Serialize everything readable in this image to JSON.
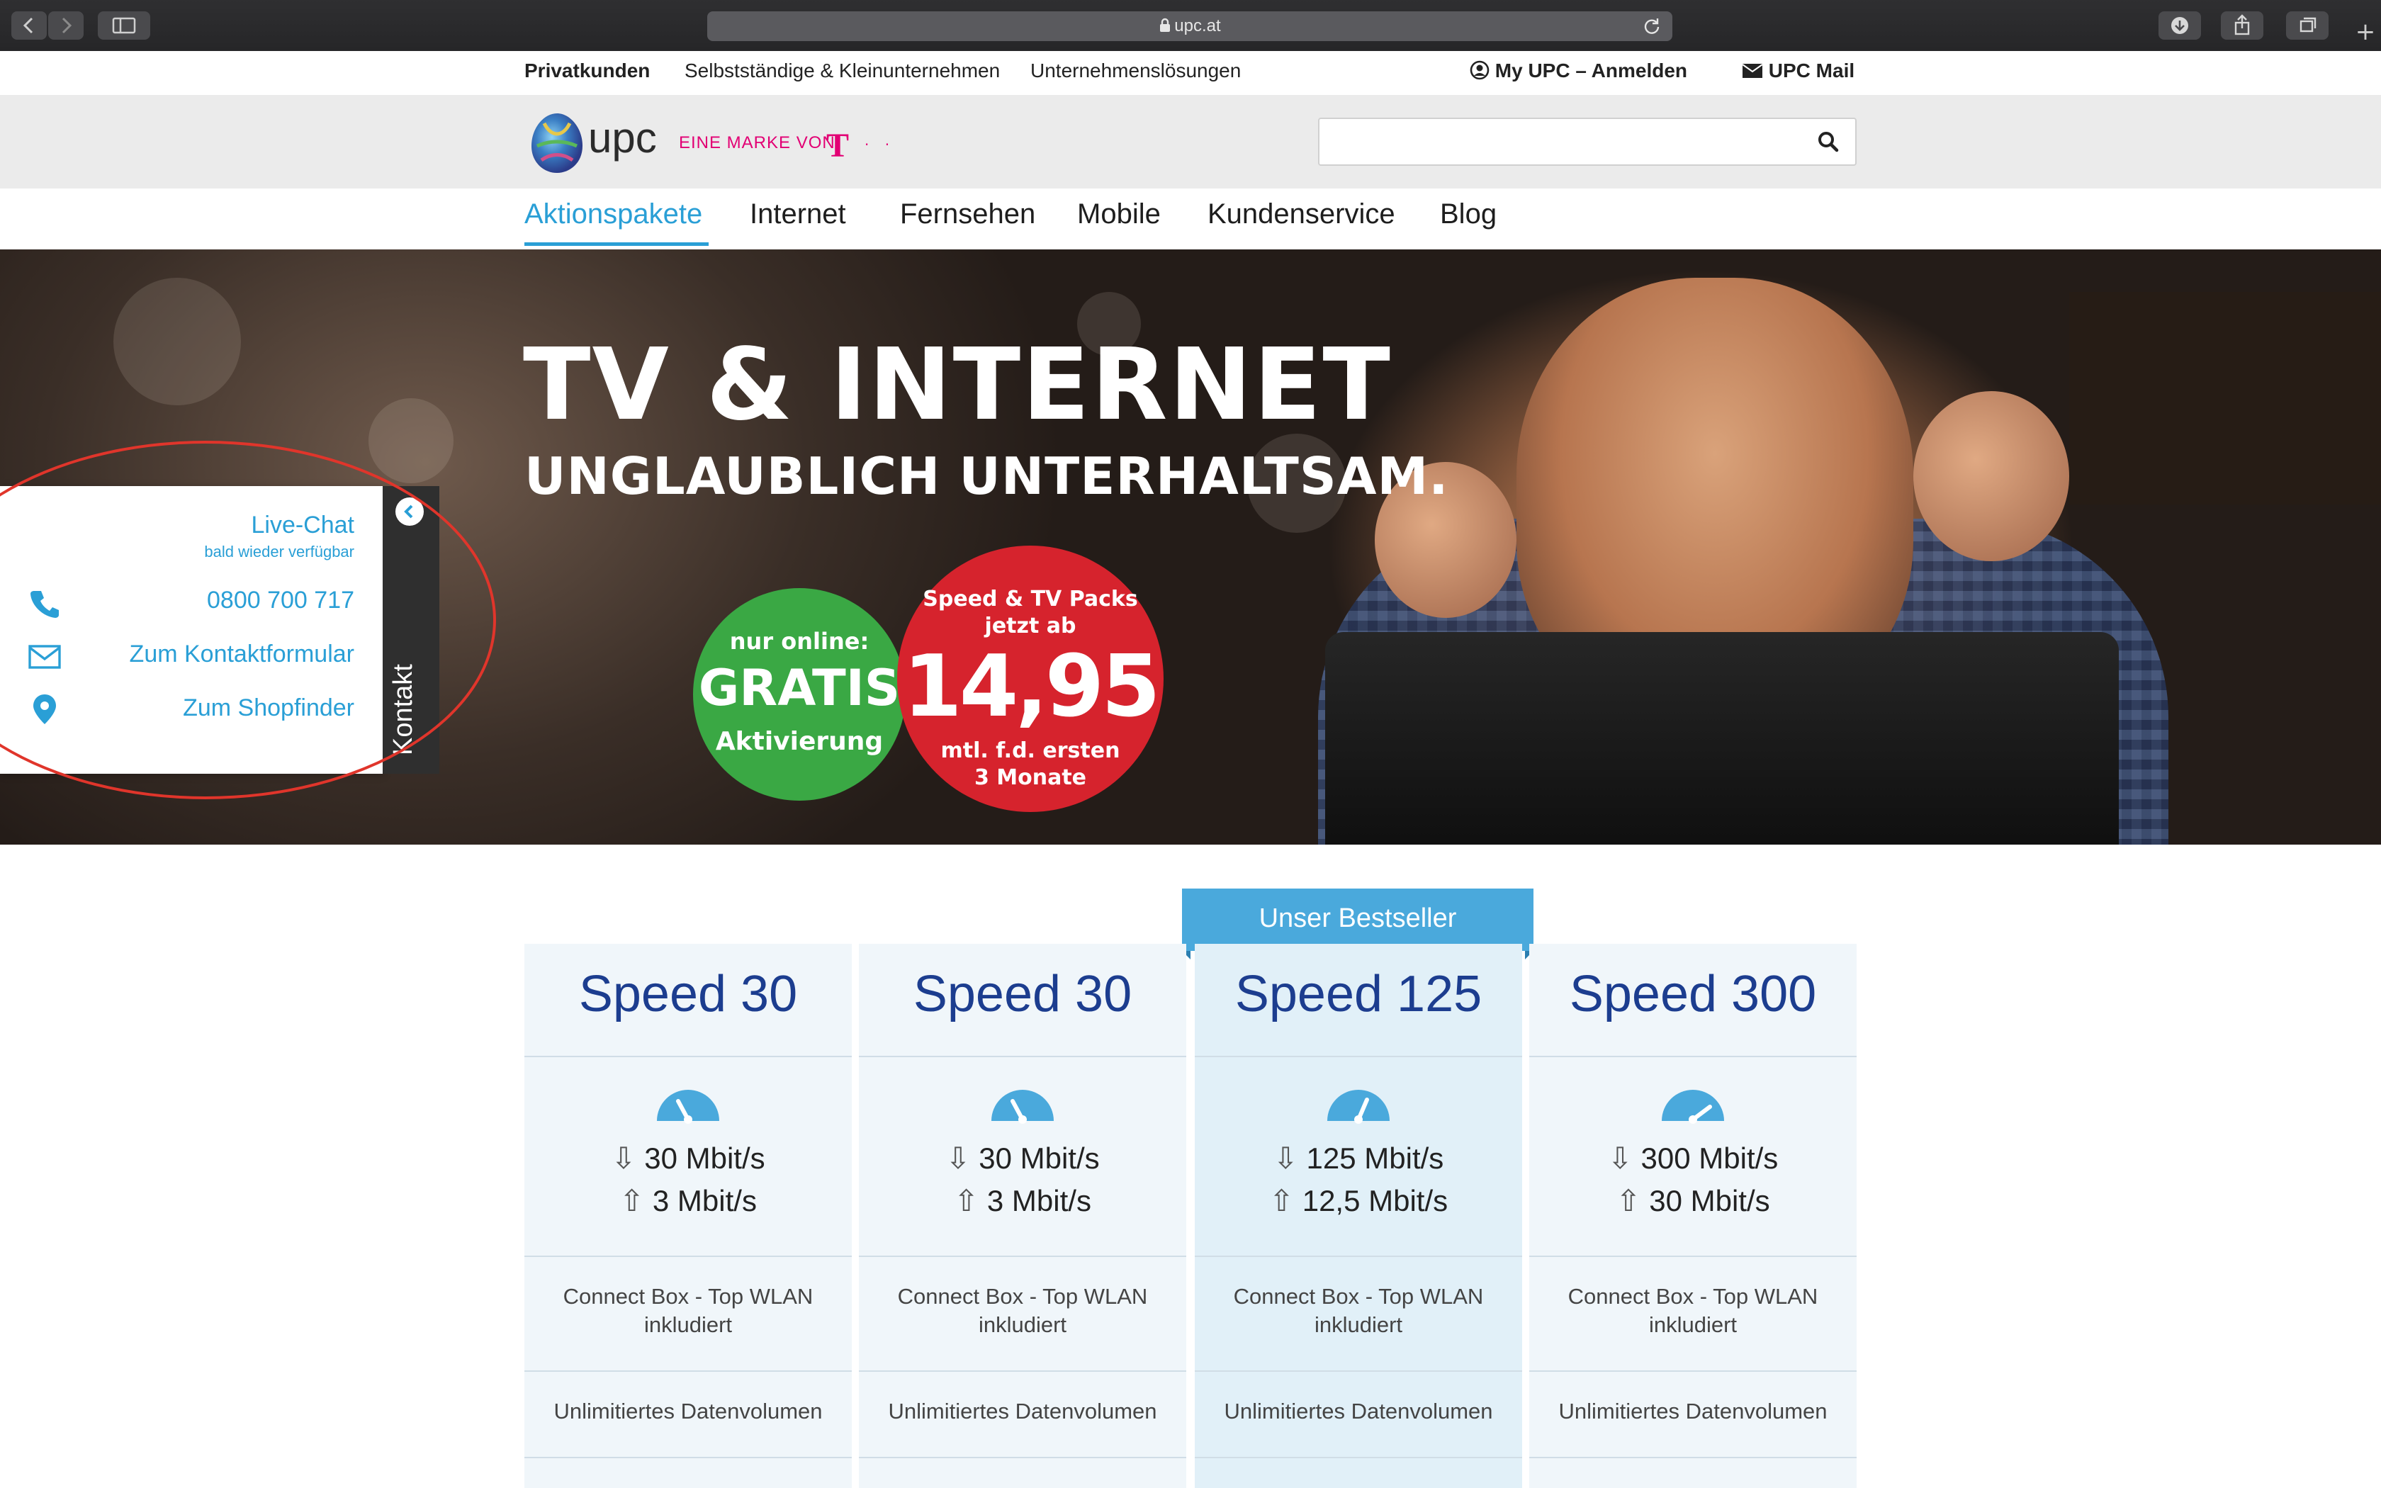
{
  "browser": {
    "url": "upc.at"
  },
  "utility_nav": {
    "items": [
      "Privatkunden",
      "Selbstständige & Kleinunternehmen",
      "Unternehmenslösungen"
    ],
    "my_upc": "My UPC – Anmelden",
    "mail": "UPC Mail"
  },
  "header": {
    "logo_text": "upc",
    "marke": "EINE MARKE VON",
    "telekom_t": "T",
    "telekom_dots": "· ·",
    "search_placeholder": ""
  },
  "main_nav": {
    "items": [
      "Aktionspakete",
      "Internet",
      "Fernsehen",
      "Mobile",
      "Kundenservice",
      "Blog"
    ],
    "active": "Aktionspakete"
  },
  "hero": {
    "title": "TV & INTERNET",
    "subtitle": "UNGLAUBLICH UNTERHALTSAM.",
    "green_badge": {
      "line1": "nur online:",
      "line2": "GRATIS",
      "line3": "Aktivierung"
    },
    "red_badge": {
      "line1": "Speed & TV Packs",
      "line2": "jetzt ab",
      "price": "14,95",
      "line3": "mtl. f.d. ersten",
      "line4": "3 Monate"
    }
  },
  "contact_panel": {
    "tab_label": "Kontakt",
    "live_chat": "Live-Chat",
    "live_chat_status": "bald wieder verfügbar",
    "phone": "0800 700 717",
    "form": "Zum Kontaktformular",
    "shop": "Zum Shopfinder"
  },
  "pricing": {
    "bestseller_label": "Unser Bestseller",
    "plans": [
      {
        "name": "Speed 30",
        "down": "30 Mbit/s",
        "up": "3 Mbit/s",
        "feature1_a": "Connect Box - Top WLAN",
        "feature1_b": "inkludiert",
        "feature2": "Unlimitiertes Datenvolumen"
      },
      {
        "name": "Speed 30",
        "down": "30 Mbit/s",
        "up": "3 Mbit/s",
        "feature1_a": "Connect Box - Top WLAN",
        "feature1_b": "inkludiert",
        "feature2": "Unlimitiertes Datenvolumen"
      },
      {
        "name": "Speed 125",
        "down": "125 Mbit/s",
        "up": "12,5 Mbit/s",
        "feature1_a": "Connect Box - Top WLAN",
        "feature1_b": "inkludiert",
        "feature2": "Unlimitiertes Datenvolumen"
      },
      {
        "name": "Speed 300",
        "down": "300 Mbit/s",
        "up": "30 Mbit/s",
        "feature1_a": "Connect Box - Top WLAN",
        "feature1_b": "inkludiert",
        "feature2": "Unlimitiertes Datenvolumen"
      }
    ]
  },
  "colors": {
    "brand_blue": "#2a9fd6",
    "title_blue": "#1c3d8f",
    "green": "#3aa844",
    "red": "#d6232d",
    "magenta": "#e20074"
  }
}
